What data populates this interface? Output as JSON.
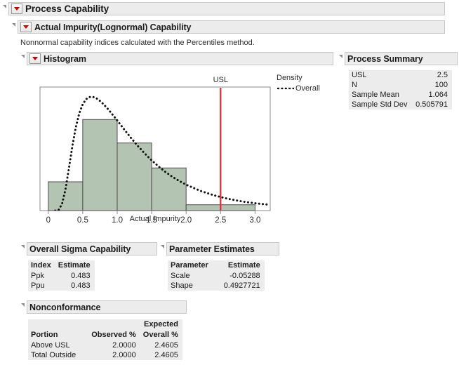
{
  "headers": {
    "process_capability": "Process Capability",
    "actual_impurity": "Actual Impurity(Lognormal) Capability",
    "histogram": "Histogram",
    "process_summary": "Process Summary",
    "overall_sigma": "Overall Sigma Capability",
    "parameter_estimates": "Parameter Estimates",
    "nonconformance": "Nonconformance"
  },
  "description": "Nonnormal capability indices calculated with the Percentiles method.",
  "process_summary": {
    "rows": [
      {
        "label": "USL",
        "value": "2.5"
      },
      {
        "label": "N",
        "value": "100"
      },
      {
        "label": "Sample Mean",
        "value": "1.064"
      },
      {
        "label": "Sample Std Dev",
        "value": "0.505791"
      }
    ]
  },
  "overall_sigma": {
    "columns": [
      "Index",
      "Estimate"
    ],
    "rows": [
      {
        "index": "Ppk",
        "estimate": "0.483"
      },
      {
        "index": "Ppu",
        "estimate": "0.483"
      }
    ]
  },
  "parameter_estimates": {
    "columns": [
      "Parameter",
      "Estimate"
    ],
    "rows": [
      {
        "parameter": "Scale",
        "estimate": "-0.05288"
      },
      {
        "parameter": "Shape",
        "estimate": "0.4927721"
      }
    ]
  },
  "nonconformance": {
    "columns": [
      "Portion",
      "Observed %",
      "Expected",
      "Overall %"
    ],
    "rows": [
      {
        "portion": "Above USL",
        "observed": "2.0000",
        "expected_overall": "2.4605"
      },
      {
        "portion": "Total Outside",
        "observed": "2.0000",
        "expected_overall": "2.4605"
      }
    ]
  },
  "legend": {
    "title": "Density",
    "series": "Overall"
  },
  "colors": {
    "bar_fill": "#b3c4b2",
    "bar_stroke": "#4c4c4c",
    "usl_line": "#ee2233",
    "curve": "#111111",
    "header_bg": "#ececec",
    "header_border": "#c8c8c8",
    "dropdown_red": "#cc0000"
  },
  "chart_data": {
    "type": "bar",
    "title": "Histogram",
    "xlabel": "Actual Impurity",
    "ylabel": "",
    "xlim": [
      -0.12,
      3.22
    ],
    "xticks": [
      0,
      0.5,
      1.0,
      1.5,
      2.0,
      2.5,
      3.0
    ],
    "xtick_labels": [
      "0",
      "0.5",
      "1.0",
      "1.5",
      "2.0",
      "2.5",
      "3.0"
    ],
    "grid": false,
    "bin_width": 0.5,
    "bin_edges": [
      0,
      0.5,
      1.0,
      1.5,
      2.0,
      2.5,
      3.0
    ],
    "counts": [
      13,
      38,
      27,
      17,
      2,
      2
    ],
    "bar_frac_of_axis": [
      0.233,
      0.737,
      0.547,
      0.345,
      0.047,
      0.047
    ],
    "reference_lines": [
      {
        "label": "USL",
        "value": 2.5,
        "color": "#ee2233"
      }
    ],
    "curves": [
      {
        "name": "Overall",
        "style": "dotted",
        "distribution": "Lognormal",
        "scale": -0.05288,
        "shape": 0.4927721,
        "points_x": [
          0.1,
          0.15,
          0.2,
          0.25,
          0.3,
          0.35,
          0.4,
          0.45,
          0.5,
          0.55,
          0.6,
          0.65,
          0.7,
          0.75,
          0.8,
          0.85,
          0.9,
          0.95,
          1.0,
          1.1,
          1.2,
          1.3,
          1.4,
          1.5,
          1.6,
          1.7,
          1.8,
          1.9,
          2.0,
          2.2,
          2.4,
          2.6,
          2.8,
          3.0,
          3.2
        ],
        "points_y": [
          0.0,
          0.006,
          0.055,
          0.178,
          0.355,
          0.539,
          0.696,
          0.812,
          0.887,
          0.93,
          0.947,
          0.948,
          0.936,
          0.915,
          0.888,
          0.857,
          0.823,
          0.788,
          0.752,
          0.678,
          0.606,
          0.538,
          0.476,
          0.419,
          0.368,
          0.322,
          0.282,
          0.247,
          0.216,
          0.166,
          0.128,
          0.099,
          0.077,
          0.061,
          0.049
        ]
      }
    ],
    "legend": {
      "title": "Density",
      "entries": [
        "Overall"
      ],
      "position": "right"
    }
  }
}
